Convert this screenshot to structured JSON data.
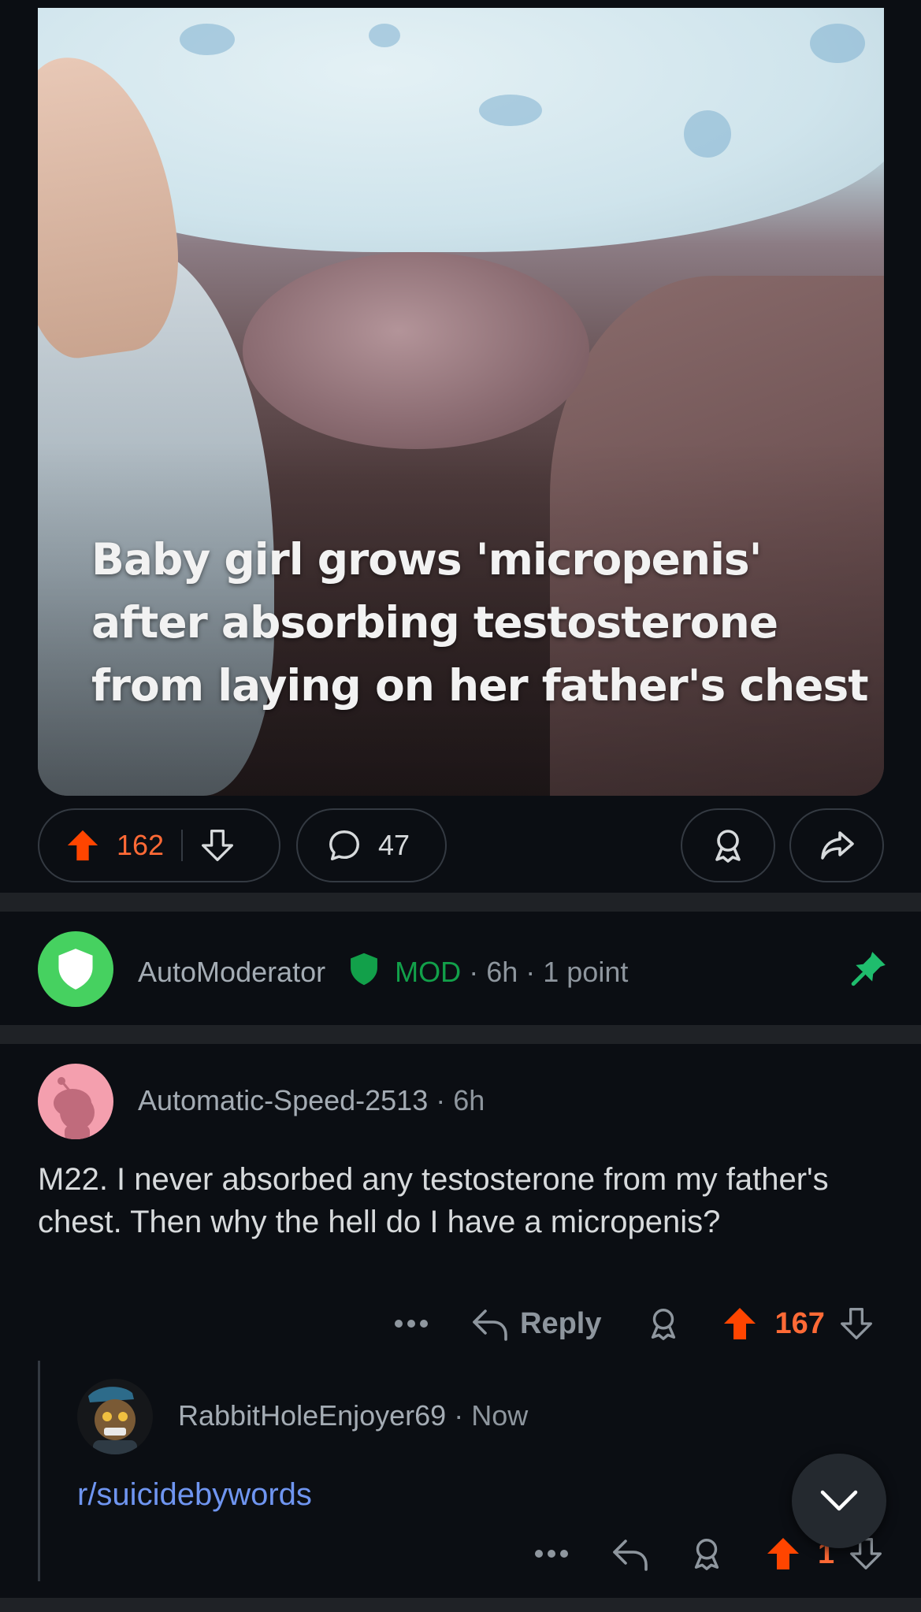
{
  "post": {
    "image_caption": "Baby girl grows  'micropenis' after absorbing testosterone from laying on her father's chest",
    "upvotes": "162",
    "comments": "47"
  },
  "automod": {
    "username": "AutoModerator",
    "badge": "MOD",
    "time": "6h",
    "points": "1 point",
    "accent": "#46d160"
  },
  "comment1": {
    "username": "Automatic-Speed-2513",
    "time": "6h",
    "body": "M22. I never absorbed any testosterone from my father's chest. Then why the hell do I have a micropenis?",
    "reply_label": "Reply",
    "votes": "167"
  },
  "comment2": {
    "username": "RabbitHoleEnjoyer69",
    "time": "Now",
    "body": "r/suicidebywords",
    "votes": "1"
  },
  "colors": {
    "background": "#0b0e13",
    "upvote": "#ff4500",
    "link": "#6f95f0",
    "mod": "#12a04a"
  }
}
